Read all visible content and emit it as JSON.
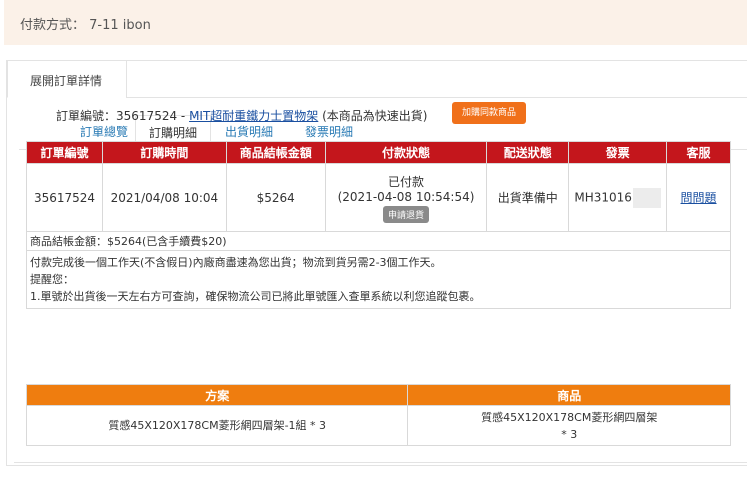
{
  "payment": {
    "label": "付款方式：",
    "value": "7-11 ibon"
  },
  "panel": {
    "tab_label": "展開訂單詳情"
  },
  "subtabs": [
    {
      "label": "訂單總覽",
      "active": false
    },
    {
      "label": "訂購明細",
      "active": true
    },
    {
      "label": "出貨明細",
      "active": false
    },
    {
      "label": "發票明細",
      "active": false
    }
  ],
  "order": {
    "number_label": "訂單編號：",
    "number": "35617524",
    "separator": " - ",
    "product_link": "MIT超耐重鐵力士置物架",
    "note": " (本商品為快速出貨)",
    "add_same_button": "加購同款商品"
  },
  "main_table": {
    "headers": [
      "訂單編號",
      "訂購時間",
      "商品結帳金額",
      "付款狀態",
      "配送狀態",
      "發票",
      "客服"
    ],
    "row": {
      "order_no": "35617524",
      "order_time": "2021/04/08 10:04",
      "amount": "$5264",
      "payment_status": "已付款",
      "payment_time": "(2021-04-08 10:54:54)",
      "refund_button": "申請退貨",
      "delivery_status": "出貨準備中",
      "invoice": "MH31016",
      "service_link": "問問題"
    },
    "summary": "商品結帳金額：$5264(已含手續費$20)",
    "notes": [
      "付款完成後一個工作天(不含假日)內廠商盡速為您出貨；物流到貨另需2-3個工作天。",
      "提醒您：",
      "1.單號於出貨後一天左右方可查詢，確保物流公司已將此單號匯入查單系統以利您追蹤包裹。"
    ]
  },
  "plan_table": {
    "headers": [
      "方案",
      "商品"
    ],
    "plan_text": "質感45X120X178CM菱形網四層架-1組 * 3",
    "product_text": "質感45X120X178CM菱形網四層架",
    "product_qty": "* 3"
  },
  "colors": {
    "header_red": "#c4161c",
    "header_orange": "#ef7d0f",
    "button_orange": "#f0701a",
    "payment_bg": "#fbf1e8"
  }
}
